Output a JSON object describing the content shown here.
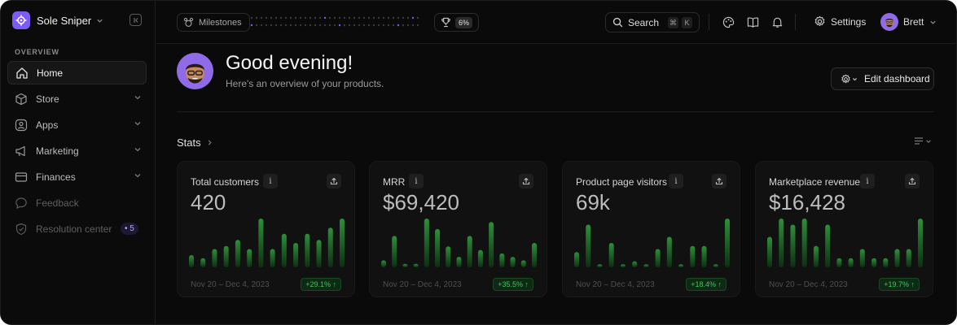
{
  "brand": {
    "name": "Sole Sniper"
  },
  "sidebar": {
    "section": "OVERVIEW",
    "items": [
      {
        "label": "Home",
        "icon": "home-icon"
      },
      {
        "label": "Store",
        "icon": "box-icon"
      },
      {
        "label": "Apps",
        "icon": "apps-icon"
      },
      {
        "label": "Marketing",
        "icon": "megaphone-icon"
      },
      {
        "label": "Finances",
        "icon": "card-icon"
      },
      {
        "label": "Feedback",
        "icon": "chat-icon"
      },
      {
        "label": "Resolution center",
        "icon": "shield-icon",
        "badge": "5"
      }
    ]
  },
  "topbar": {
    "milestones": "Milestones",
    "progress_pct": "6%",
    "search": "Search",
    "search_keys": [
      "⌘",
      "K"
    ],
    "settings": "Settings",
    "user": "Brett"
  },
  "header": {
    "greeting": "Good evening!",
    "subtitle": "Here's an overview of your products.",
    "edit_button": "Edit dashboard"
  },
  "stats": {
    "title": "Stats",
    "cards": [
      {
        "title": "Total customers",
        "value": "420",
        "range": "Nov 20 – Dec 4, 2023",
        "delta": "+29.1%"
      },
      {
        "title": "MRR",
        "value": "$69,420",
        "range": "Nov 20 – Dec 4, 2023",
        "delta": "+35.5%"
      },
      {
        "title": "Product page visitors",
        "value": "69k",
        "range": "Nov 20 – Dec 4, 2023",
        "delta": "+18.4%"
      },
      {
        "title": "Marketplace revenue",
        "value": "$16,428",
        "range": "Nov 20 – Dec 4, 2023",
        "delta": "+19.7%"
      }
    ]
  },
  "chart_data": [
    {
      "type": "bar",
      "values": [
        2,
        1.5,
        3,
        3.5,
        4.5,
        3,
        8,
        3,
        5.5,
        4,
        5.5,
        4.5,
        6.5,
        8
      ]
    },
    {
      "type": "bar",
      "values": [
        1,
        4.5,
        0.5,
        0.5,
        7,
        5.5,
        3,
        1.5,
        4.5,
        2.5,
        6.5,
        2,
        1.5,
        1,
        3.5
      ]
    },
    {
      "type": "bar",
      "values": [
        2.5,
        7,
        0.5,
        4,
        0.5,
        1,
        0.5,
        3,
        5,
        0.5,
        3.5,
        3.5,
        0.5,
        8
      ]
    },
    {
      "type": "bar",
      "values": [
        5,
        8,
        7,
        8,
        3.5,
        7,
        1.5,
        1.5,
        3,
        1.5,
        1.5,
        3,
        3,
        8
      ]
    }
  ],
  "colors": {
    "accent": "#7c5cf5",
    "positive": "#3cc85a",
    "bar_top": "#2e8f3a",
    "bar_bottom": "#0e2f13"
  }
}
